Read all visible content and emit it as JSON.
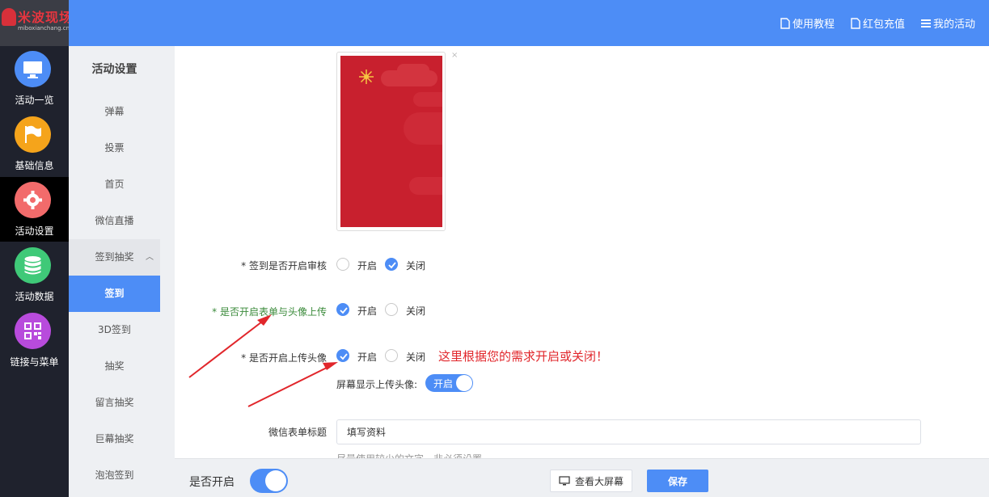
{
  "brand": {
    "name": "米波现场",
    "domain": "miboxianchang.cn"
  },
  "rail": {
    "items": [
      {
        "label": "活动一览",
        "icon": "monitor-icon",
        "color": "#4d8df6"
      },
      {
        "label": "基础信息",
        "icon": "flag-icon",
        "color": "#f5a41b"
      },
      {
        "label": "活动设置",
        "icon": "gear-icon",
        "color": "#f26b6b"
      },
      {
        "label": "活动数据",
        "icon": "database-icon",
        "color": "#3fc978"
      },
      {
        "label": "链接与菜单",
        "icon": "qrcode-icon",
        "color": "#b84bdc"
      }
    ],
    "active_index": 2
  },
  "header": {
    "links": [
      {
        "label": "使用教程",
        "icon": "document-icon"
      },
      {
        "label": "红包充值",
        "icon": "document-icon"
      },
      {
        "label": "我的活动",
        "icon": "menu-icon"
      }
    ]
  },
  "submenu": {
    "title": "活动设置",
    "items": [
      "弹幕",
      "投票",
      "首页",
      "微信直播",
      "签到抽奖",
      "签到",
      "3D签到",
      "抽奖",
      "留言抽奖",
      "巨幕抽奖",
      "泡泡签到"
    ],
    "active": "签到",
    "expanded_group": "签到抽奖"
  },
  "form": {
    "review": {
      "label": "* 签到是否开启审核",
      "options": [
        "开启",
        "关闭"
      ],
      "selected": "关闭"
    },
    "form_upload": {
      "label": "* 是否开启表单与头像上传",
      "options": [
        "开启",
        "关闭"
      ],
      "selected": "开启"
    },
    "avatar_upload": {
      "label": "* 是否开启上传头像",
      "options": [
        "开启",
        "关闭"
      ],
      "selected": "开启"
    },
    "note": "这里根据您的需求开启或关闭！",
    "screen_show": {
      "label": "屏幕显示上传头像:",
      "toggle_text": "开启",
      "on": true
    },
    "wechat_title": {
      "label": "微信表单标题",
      "value": "填写资料",
      "hint": "尽量使用较少的文字，非必须设置"
    }
  },
  "bottom": {
    "enable_label": "是否开启",
    "enabled": true,
    "screen_button": "查看大屏幕",
    "save_button": "保存"
  },
  "colors": {
    "accent": "#4d8df6",
    "rail_bg": "#1f222d",
    "note": "#e1262b",
    "poster": "#c8202e"
  }
}
